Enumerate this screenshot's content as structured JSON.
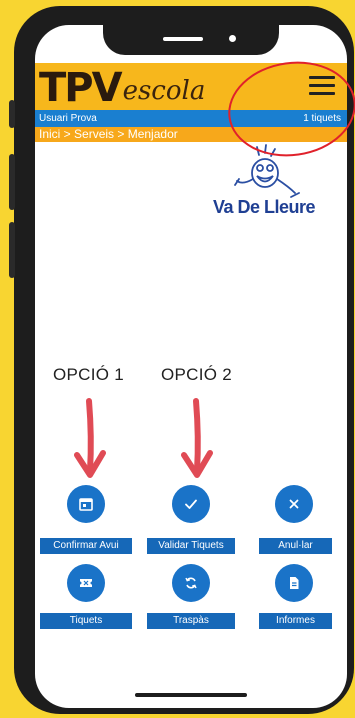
{
  "app": {
    "logo_main": "TPV",
    "logo_sub": "escola"
  },
  "topbar": {
    "user": "Usuari Prova",
    "tickets": "1 tiquets"
  },
  "breadcrumb": {
    "text": "Inici > Serveis > Menjador"
  },
  "brand_logo": {
    "text": "Va De Lleure"
  },
  "annotations": {
    "option1": "OPCIÓ 1",
    "option2": "OPCIÓ 2",
    "highlight_color": "#e0212b",
    "arrow_color": "#e04b55"
  },
  "actions": [
    {
      "label": "Confirmar Avui",
      "icon": "calendar-icon"
    },
    {
      "label": "Validar Tiquets",
      "icon": "check-icon"
    },
    {
      "label": "Anul·lar",
      "icon": "close-icon"
    },
    {
      "label": "Tiquets",
      "icon": "ticket-icon"
    },
    {
      "label": "Traspàs",
      "icon": "sync-icon"
    },
    {
      "label": "Informes",
      "icon": "document-icon"
    }
  ],
  "colors": {
    "background": "#f8d531",
    "header": "#f7b71c",
    "user_bar": "#1a7fd0",
    "breadcrumb": "#f7a81b",
    "accent": "#1a73c8"
  }
}
